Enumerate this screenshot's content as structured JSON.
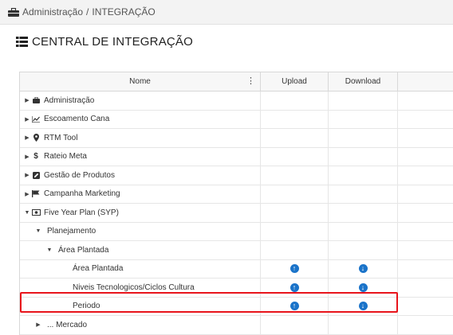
{
  "breadcrumb": {
    "root": "Administração",
    "separator": "/",
    "current": "INTEGRAÇÃO"
  },
  "title": "CENTRAL DE INTEGRAÇÃO",
  "table": {
    "col_name": "Nome",
    "col_upload": "Upload",
    "col_download": "Download",
    "rows": [
      {
        "label": "Administração",
        "icon": "briefcase-icon"
      },
      {
        "label": "Escoamento Cana",
        "icon": "line-chart-icon"
      },
      {
        "label": "RTM Tool",
        "icon": "map-marker-icon"
      },
      {
        "label": "Rateio Meta",
        "icon": "dollar-icon"
      },
      {
        "label": "Gestão de Produtos",
        "icon": "edit-icon"
      },
      {
        "label": "Campanha Marketing",
        "icon": "flag-icon"
      },
      {
        "label": "Five Year Plan (SYP)",
        "icon": "money-icon"
      },
      {
        "label": "Planejamento"
      },
      {
        "label": "Área Plantada"
      },
      {
        "label": "Área Plantada"
      },
      {
        "label": "Niveis Tecnologicos/Ciclos Cultura"
      },
      {
        "label": "Periodo"
      },
      {
        "label": "... Mercado"
      }
    ]
  },
  "colors": {
    "accent": "#1a73c9",
    "highlight": "#e8141b"
  }
}
